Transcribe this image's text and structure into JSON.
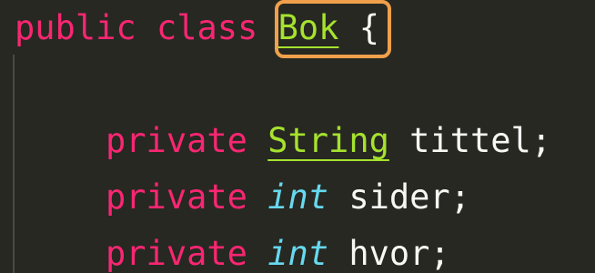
{
  "editor": {
    "lines": [
      {
        "tokens": {
          "kw1": "public",
          "kw2": "class",
          "name": "Bok",
          "brace": "{"
        }
      },
      {
        "tokens": {
          "kw": "private",
          "type": "String",
          "ident": "tittel;"
        }
      },
      {
        "tokens": {
          "kw": "private",
          "type": "int",
          "ident": "sider;"
        }
      },
      {
        "tokens": {
          "kw": "private",
          "type": "int",
          "ident": "hvor;"
        }
      }
    ]
  },
  "colors": {
    "background": "#272822",
    "keyword": "#f92672",
    "class_type": "#a6e22e",
    "primitive_type": "#66d9ef",
    "identifier": "#f8f8f2",
    "highlight_box": "#f0a04b"
  }
}
